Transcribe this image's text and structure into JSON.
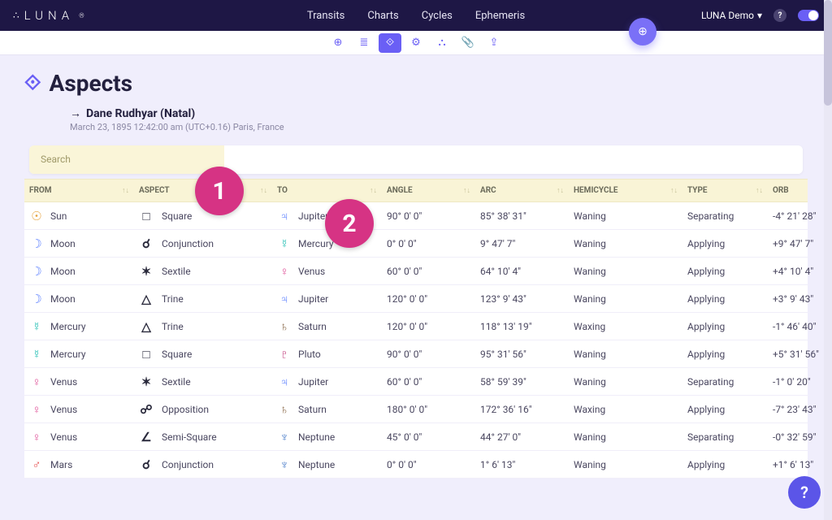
{
  "brand": "LUNA",
  "nav": {
    "links": [
      "Transits",
      "Charts",
      "Cycles",
      "Ephemeris"
    ],
    "user": "LUNA Demo"
  },
  "toolbar_icons": [
    "globe",
    "layers",
    "compass",
    "gear",
    "chart",
    "attach",
    "share"
  ],
  "page": {
    "title": "Aspects",
    "subject_name": "Dane Rudhyar (Natal)",
    "subject_meta": "March 23, 1895 12:42:00 am (UTC+0.16) Paris, France"
  },
  "search_label": "Search",
  "columns": [
    "FROM",
    "ASPECT",
    "TO",
    "ANGLE",
    "ARC",
    "HEMICYCLE",
    "TYPE",
    "ORB"
  ],
  "rows": [
    {
      "from": "Sun",
      "from_g": "☉",
      "from_c": "g-sun",
      "asp": "Square",
      "asp_s": "□",
      "to": "Jupiter",
      "to_g": "♃",
      "to_c": "g-jup",
      "angle": "90° 0' 0\"",
      "arc": "85° 38' 31\"",
      "hemi": "Waning",
      "type": "Separating",
      "orb": "-4° 21' 28\""
    },
    {
      "from": "Moon",
      "from_g": "☽",
      "from_c": "g-moon",
      "asp": "Conjunction",
      "asp_s": "☌",
      "to": "Mercury",
      "to_g": "☿",
      "to_c": "g-merc",
      "angle": "0° 0' 0\"",
      "arc": "9° 47' 7\"",
      "hemi": "Waning",
      "type": "Applying",
      "orb": "+9° 47' 7\""
    },
    {
      "from": "Moon",
      "from_g": "☽",
      "from_c": "g-moon",
      "asp": "Sextile",
      "asp_s": "✶",
      "to": "Venus",
      "to_g": "♀",
      "to_c": "g-venus",
      "angle": "60° 0' 0\"",
      "arc": "64° 10' 4\"",
      "hemi": "Waning",
      "type": "Applying",
      "orb": "+4° 10' 4\""
    },
    {
      "from": "Moon",
      "from_g": "☽",
      "from_c": "g-moon",
      "asp": "Trine",
      "asp_s": "△",
      "to": "Jupiter",
      "to_g": "♃",
      "to_c": "g-jup",
      "angle": "120° 0' 0\"",
      "arc": "123° 9' 43\"",
      "hemi": "Waning",
      "type": "Applying",
      "orb": "+3° 9' 43\""
    },
    {
      "from": "Mercury",
      "from_g": "☿",
      "from_c": "g-merc",
      "asp": "Trine",
      "asp_s": "△",
      "to": "Saturn",
      "to_g": "♄",
      "to_c": "g-sat",
      "angle": "120° 0' 0\"",
      "arc": "118° 13' 19\"",
      "hemi": "Waxing",
      "type": "Applying",
      "orb": "-1° 46' 40\""
    },
    {
      "from": "Mercury",
      "from_g": "☿",
      "from_c": "g-merc",
      "asp": "Square",
      "asp_s": "□",
      "to": "Pluto",
      "to_g": "♇",
      "to_c": "g-plu",
      "angle": "90° 0' 0\"",
      "arc": "95° 31' 56\"",
      "hemi": "Waning",
      "type": "Applying",
      "orb": "+5° 31' 56\""
    },
    {
      "from": "Venus",
      "from_g": "♀",
      "from_c": "g-venus",
      "asp": "Sextile",
      "asp_s": "✶",
      "to": "Jupiter",
      "to_g": "♃",
      "to_c": "g-jup",
      "angle": "60° 0' 0\"",
      "arc": "58° 59' 39\"",
      "hemi": "Waning",
      "type": "Separating",
      "orb": "-1° 0' 20\""
    },
    {
      "from": "Venus",
      "from_g": "♀",
      "from_c": "g-venus",
      "asp": "Opposition",
      "asp_s": "☍",
      "to": "Saturn",
      "to_g": "♄",
      "to_c": "g-sat",
      "angle": "180° 0' 0\"",
      "arc": "172° 36' 16\"",
      "hemi": "Waxing",
      "type": "Applying",
      "orb": "-7° 23' 43\""
    },
    {
      "from": "Venus",
      "from_g": "♀",
      "from_c": "g-venus",
      "asp": "Semi-Square",
      "asp_s": "∠",
      "to": "Neptune",
      "to_g": "♆",
      "to_c": "g-nep",
      "angle": "45° 0' 0\"",
      "arc": "44° 27' 0\"",
      "hemi": "Waning",
      "type": "Separating",
      "orb": "-0° 32' 59\""
    },
    {
      "from": "Mars",
      "from_g": "♂",
      "from_c": "g-mars",
      "asp": "Conjunction",
      "asp_s": "☌",
      "to": "Neptune",
      "to_g": "♆",
      "to_c": "g-nep",
      "angle": "0° 0' 0\"",
      "arc": "1° 6' 13\"",
      "hemi": "Waning",
      "type": "Applying",
      "orb": "+1° 6' 13\""
    }
  ],
  "callouts": {
    "one": "1",
    "two": "2"
  },
  "help": "?"
}
